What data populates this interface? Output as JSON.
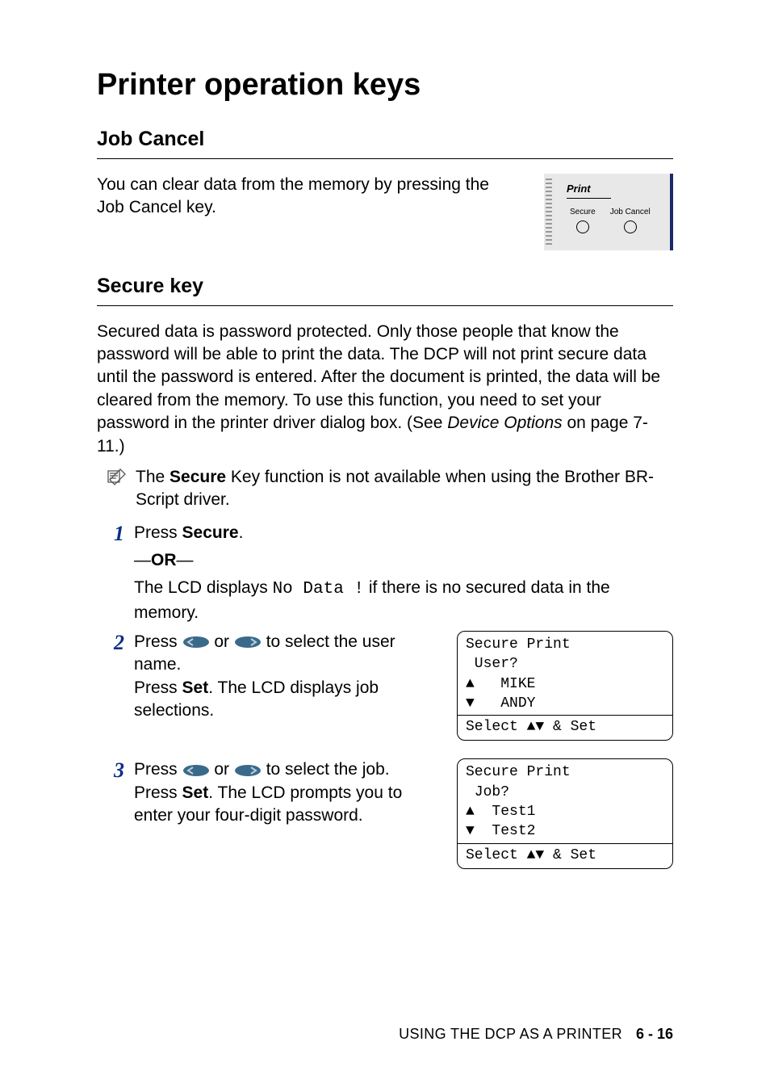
{
  "title": "Printer operation keys",
  "sections": {
    "jobCancel": {
      "heading": "Job Cancel",
      "body": "You can clear data from the memory by pressing the Job Cancel key."
    },
    "secureKey": {
      "heading": "Secure key",
      "body_pre": "Secured data is password protected. Only those people that know the password will be able to print the data. The DCP will not print secure data until the password is entered. After the document is printed, the data will be cleared from the memory. To use this function, you need to set your password in the printer driver dialog box. (See ",
      "body_link": "Device Options",
      "body_post": " on page 7-11.)",
      "note_pre": "The ",
      "note_bold": "Secure",
      "note_post": " Key function is not available when using the Brother BR-Script driver."
    }
  },
  "panel": {
    "title": "Print",
    "btn1": "Secure",
    "btn2": "Job Cancel"
  },
  "steps": {
    "s1_pre": "Press ",
    "s1_bold": "Secure",
    "s1_post": ".",
    "or_dash": "—",
    "or_word": "OR",
    "s1_alt_pre": "The LCD displays ",
    "s1_alt_mono": "No Data !",
    "s1_alt_post": " if there is no secured data in the memory.",
    "s2_l1_pre": "Press ",
    "s2_l1_mid": " or ",
    "s2_l1_post": " to select the user name.",
    "s2_l2_pre": "Press ",
    "s2_l2_bold": "Set",
    "s2_l2_post": ". The LCD displays job selections.",
    "s3_l1_pre": "Press ",
    "s3_l1_mid": " or ",
    "s3_l1_post": " to select the job.",
    "s3_l2_pre": "Press ",
    "s3_l2_bold": "Set",
    "s3_l2_post": ". The LCD prompts you to enter your four-digit password."
  },
  "lcd1": {
    "l1": "Secure Print",
    "l2": " User?",
    "l3_item": "MIKE",
    "l4_item": "ANDY",
    "footer": "Select ▲▼ & Set"
  },
  "lcd2": {
    "l1": "Secure Print",
    "l2": " Job?",
    "l3_item": "Test1",
    "l4_item": "Test2",
    "footer": "Select ▲▼ & Set"
  },
  "footer": {
    "text": "USING THE DCP AS A PRINTER",
    "page": "6 - 16"
  },
  "nums": {
    "n1": "1",
    "n2": "2",
    "n3": "3"
  }
}
